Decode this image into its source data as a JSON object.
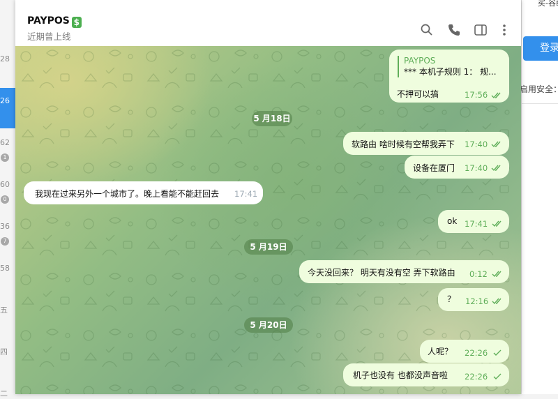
{
  "sidebar_partial": {
    "numbers": [
      "28",
      "26",
      "62",
      "60",
      "36",
      "58"
    ],
    "badges": [
      "1",
      "0",
      "7"
    ],
    "weekdays": [
      "五",
      "四",
      "二"
    ]
  },
  "background_window": {
    "top_text": "买-谷歌...",
    "login_label": "登录",
    "safe_text": "启用安全："
  },
  "header": {
    "title": "PAYPOS",
    "title_emoji": "$",
    "status": "近期曾上线"
  },
  "colors": {
    "accent": "#3390ec",
    "bubble_out": "#effdde",
    "time_out": "#5fae59"
  },
  "messages": [
    {
      "dir": "out",
      "reply_name": "PAYPOS",
      "reply_text": "*** 本机子规则  1：  规...",
      "text": "不押可以搞",
      "time": "17:56",
      "ticks": "double"
    },
    {
      "type": "date",
      "text": "5 月18日"
    },
    {
      "dir": "out",
      "text": "软路由 啥时候有空帮我弄下",
      "time": "17:40",
      "ticks": "double"
    },
    {
      "dir": "out",
      "text": "设备在厦门",
      "time": "17:40",
      "ticks": "double"
    },
    {
      "dir": "in",
      "text": "我现在过来另外一个城市了。晚上看能不能赶回去",
      "time": "17:41"
    },
    {
      "dir": "out",
      "text": "ok",
      "time": "17:41",
      "ticks": "double"
    },
    {
      "type": "date",
      "text": "5 月19日"
    },
    {
      "dir": "out",
      "text": "今天没回来？  明天有没有空 弄下软路由",
      "time": "0:12",
      "ticks": "double"
    },
    {
      "dir": "out",
      "text": "？",
      "time": "12:16",
      "ticks": "double"
    },
    {
      "type": "date",
      "text": "5 月20日"
    },
    {
      "dir": "out",
      "text": "人呢？",
      "time": "22:26",
      "ticks": "single"
    },
    {
      "dir": "out",
      "text": "机子也没有   也都没声音啦",
      "time": "22:26",
      "ticks": "single"
    }
  ]
}
